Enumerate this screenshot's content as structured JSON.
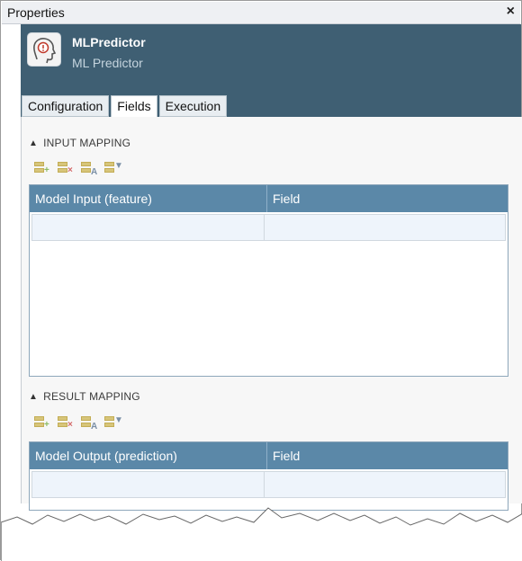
{
  "window": {
    "title": "Properties",
    "close_glyph": "×"
  },
  "node": {
    "name": "MLPredictor",
    "subtitle": "ML Predictor",
    "icon": "head-predictor-icon"
  },
  "tabs": [
    {
      "label": "Configuration",
      "active": false
    },
    {
      "label": "Fields",
      "active": true
    },
    {
      "label": "Execution",
      "active": false
    }
  ],
  "input_mapping": {
    "heading": "INPUT MAPPING",
    "toolbar": [
      "add-row-icon",
      "delete-row-icon",
      "auto-map-icon",
      "more-options-icon"
    ],
    "columns": [
      "Model Input (feature)",
      "Field"
    ],
    "rows": [
      [
        "",
        ""
      ]
    ]
  },
  "result_mapping": {
    "heading": "RESULT MAPPING",
    "toolbar": [
      "add-row-icon",
      "delete-row-icon",
      "auto-map-icon",
      "more-options-icon"
    ],
    "columns": [
      "Model Output (prediction)",
      "Field"
    ],
    "rows": [
      [
        "",
        ""
      ]
    ]
  },
  "colors": {
    "header_bg": "#3f5f73",
    "grid_header": "#5b88a8",
    "row_bg": "#eef4fb"
  }
}
